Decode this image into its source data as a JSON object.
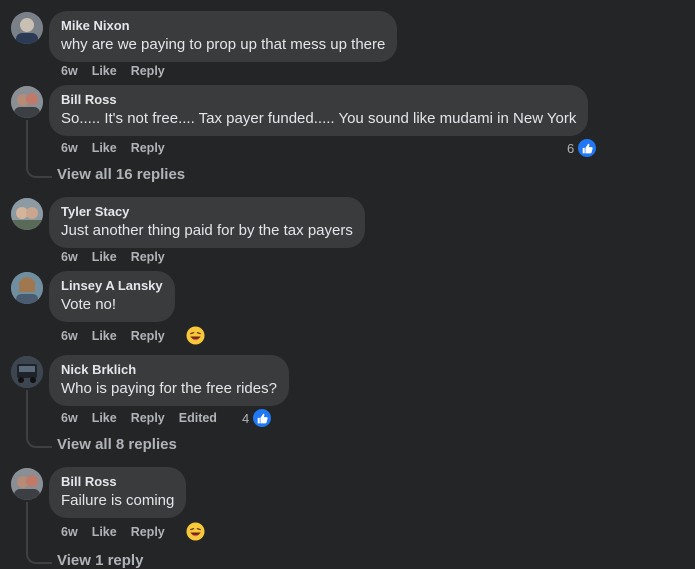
{
  "comments": [
    {
      "author": "Mike Nixon",
      "text": "why are we paying to prop up that mess up there",
      "time": "6w",
      "like": "Like",
      "reply": "Reply"
    },
    {
      "author": "Bill Ross",
      "text": "So..... It's not free.... Tax payer funded..... You sound like mudami in New York",
      "time": "6w",
      "like": "Like",
      "reply": "Reply",
      "reactions": "6",
      "view_replies": "View all 16 replies"
    },
    {
      "author": "Tyler Stacy",
      "text": "Just another thing paid for by the tax payers",
      "time": "6w",
      "like": "Like",
      "reply": "Reply"
    },
    {
      "author": "Linsey A Lansky",
      "text": "Vote no!",
      "time": "6w",
      "like": "Like",
      "reply": "Reply",
      "emoji": "laughing-emoji"
    },
    {
      "author": "Nick Brklich",
      "text": "Who is paying for the free rides?",
      "time": "6w",
      "like": "Like",
      "reply": "Reply",
      "edited": "Edited",
      "reactions": "4",
      "view_replies": "View all 8 replies"
    },
    {
      "author": "Bill Ross",
      "text": "Failure is coming",
      "time": "6w",
      "like": "Like",
      "reply": "Reply",
      "emoji": "laughing-emoji",
      "view_replies": "View 1 reply"
    }
  ],
  "colors": {
    "background": "#242526",
    "bubble": "#3a3b3c",
    "text": "#e4e6eb",
    "muted": "#b0b3b8",
    "like_blue": "#2078f4"
  }
}
